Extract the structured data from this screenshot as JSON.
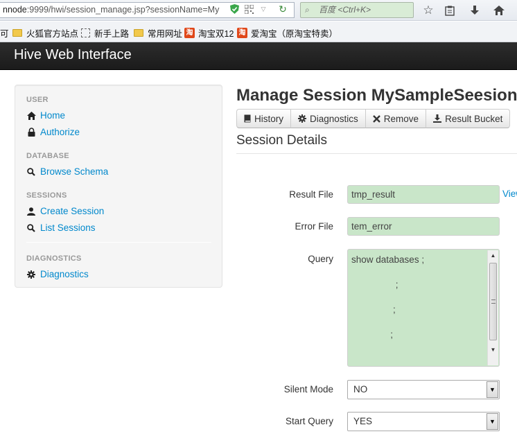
{
  "browser": {
    "url_host": "nnode",
    "url_rest": ":9999/hwi/session_manage.jsp?sessionName=My",
    "search_placeholder": "百度 <Ctrl+K>",
    "bookmarks": [
      "可",
      "火狐官方站点",
      "新手上路",
      "常用网址",
      "淘宝双12",
      "爱淘宝（原淘宝特卖）"
    ],
    "taobao_badge": "淘"
  },
  "navbar": {
    "brand": "Hive Web Interface"
  },
  "sidebar": {
    "sections": [
      {
        "header": "USER",
        "items": [
          {
            "label": "Home",
            "icon": "home-icon"
          },
          {
            "label": "Authorize",
            "icon": "lock-icon"
          }
        ]
      },
      {
        "header": "DATABASE",
        "items": [
          {
            "label": "Browse Schema",
            "icon": "search-icon"
          }
        ]
      },
      {
        "header": "SESSIONS",
        "items": [
          {
            "label": "Create Session",
            "icon": "user-icon"
          },
          {
            "label": "List Sessions",
            "icon": "search-icon"
          }
        ]
      },
      {
        "header": "DIAGNOSTICS",
        "items": [
          {
            "label": "Diagnostics",
            "icon": "gear-icon"
          }
        ]
      }
    ]
  },
  "main": {
    "title": "Manage Session MySampleSeesion",
    "buttons": [
      {
        "label": "History",
        "icon": "book-icon"
      },
      {
        "label": "Diagnostics",
        "icon": "gear-icon"
      },
      {
        "label": "Remove",
        "icon": "close-icon"
      },
      {
        "label": "Result Bucket",
        "icon": "download-icon"
      }
    ],
    "section_title": "Session Details",
    "form": {
      "result_file_label": "Result File",
      "result_file_value": "tmp_result",
      "view_link": "View",
      "error_file_label": "Error File",
      "error_file_value": "tem_error",
      "query_label": "Query",
      "query_value": "show databases ;\n\n                 ;\n\n                ;\n\n               ;",
      "silent_mode_label": "Silent Mode",
      "silent_mode_value": "NO",
      "start_query_label": "Start Query",
      "start_query_value": "YES"
    }
  },
  "colors": {
    "link": "#0088cc",
    "navbar": "#1b1b1b",
    "input_bg": "#c9e6c9"
  }
}
